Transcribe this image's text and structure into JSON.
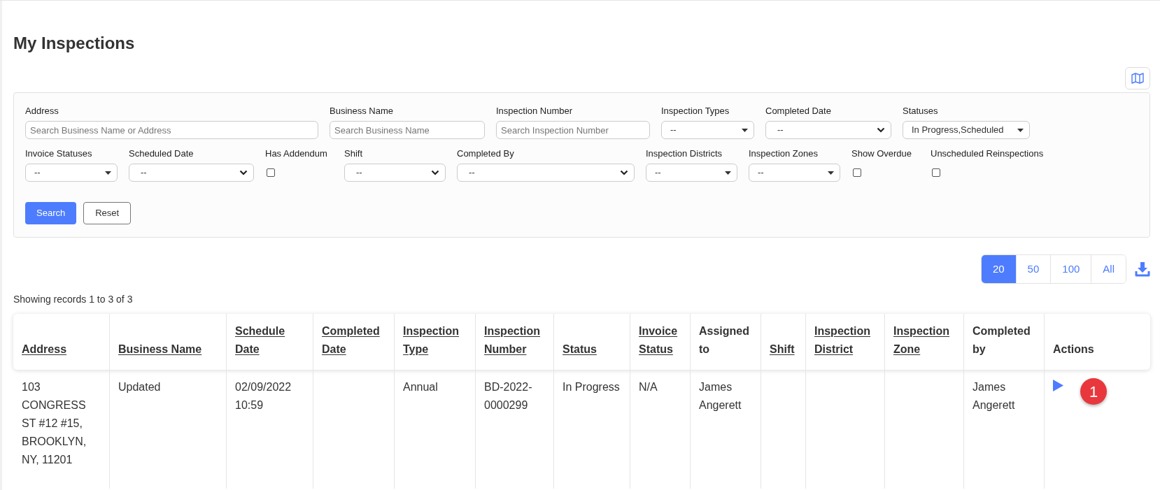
{
  "page": {
    "title": "My Inspections"
  },
  "filters": {
    "fields": [
      {
        "label": "Address",
        "kind": "text",
        "placeholder": "Search Business Name or Address"
      },
      {
        "label": "Business Name",
        "kind": "text",
        "placeholder": "Search Business Name"
      },
      {
        "label": "Inspection Number",
        "kind": "text",
        "placeholder": "Search Inspection Number"
      },
      {
        "label": "Inspection Types",
        "kind": "dropdown",
        "value": "--"
      },
      {
        "label": "Completed Date",
        "kind": "select",
        "value": "--"
      },
      {
        "label": "Statuses",
        "kind": "dropdown",
        "value": "In Progress,Scheduled"
      },
      {
        "label": "Invoice Statuses",
        "kind": "dropdown",
        "value": "--"
      },
      {
        "label": "Scheduled Date",
        "kind": "select",
        "value": "--"
      },
      {
        "label": "Has Addendum",
        "kind": "checkbox",
        "checked": false
      },
      {
        "label": "Shift",
        "kind": "select",
        "value": "--"
      },
      {
        "label": "Completed By",
        "kind": "select",
        "value": "--"
      },
      {
        "label": "Inspection Districts",
        "kind": "dropdown",
        "value": "--"
      },
      {
        "label": "Inspection Zones",
        "kind": "dropdown",
        "value": "--"
      },
      {
        "label": "Show Overdue",
        "kind": "checkbox",
        "checked": false
      },
      {
        "label": "Unscheduled Reinspections",
        "kind": "checkbox",
        "checked": false
      }
    ],
    "buttons": [
      {
        "label": "Search",
        "kind": "primary"
      },
      {
        "label": "Reset",
        "kind": "secondary"
      }
    ]
  },
  "page_sizes": [
    {
      "label": "20",
      "selected": true
    },
    {
      "label": "50",
      "selected": false
    },
    {
      "label": "100",
      "selected": false
    },
    {
      "label": "All",
      "selected": false
    }
  ],
  "records_summary": "Showing records 1 to 3 of 3",
  "table": {
    "columns": [
      {
        "label": "Address",
        "sortable": true
      },
      {
        "label": "Business Name",
        "sortable": true
      },
      {
        "label": "Schedule Date",
        "sortable": true
      },
      {
        "label": "Completed Date",
        "sortable": true
      },
      {
        "label": "Inspection Type",
        "sortable": true
      },
      {
        "label": "Inspection Number",
        "sortable": true
      },
      {
        "label": "Status",
        "sortable": true
      },
      {
        "label": "Invoice Status",
        "sortable": true
      },
      {
        "label": "Assigned to",
        "sortable": false
      },
      {
        "label": "Shift",
        "sortable": true
      },
      {
        "label": "Inspection District",
        "sortable": true
      },
      {
        "label": "Inspection Zone",
        "sortable": true
      },
      {
        "label": "Completed by",
        "sortable": false
      },
      {
        "label": "Actions",
        "sortable": false
      }
    ],
    "rows": [
      {
        "cells": [
          "103 CONGRESS ST #12 #15, BROOKLYN, NY, 11201",
          "Updated",
          "02/09/2022 10:59",
          "",
          "Annual",
          "BD-2022-0000299",
          "In Progress",
          "N/A",
          "James Angerett",
          "",
          "",
          "",
          "James Angerett"
        ],
        "badge": "1"
      }
    ]
  }
}
